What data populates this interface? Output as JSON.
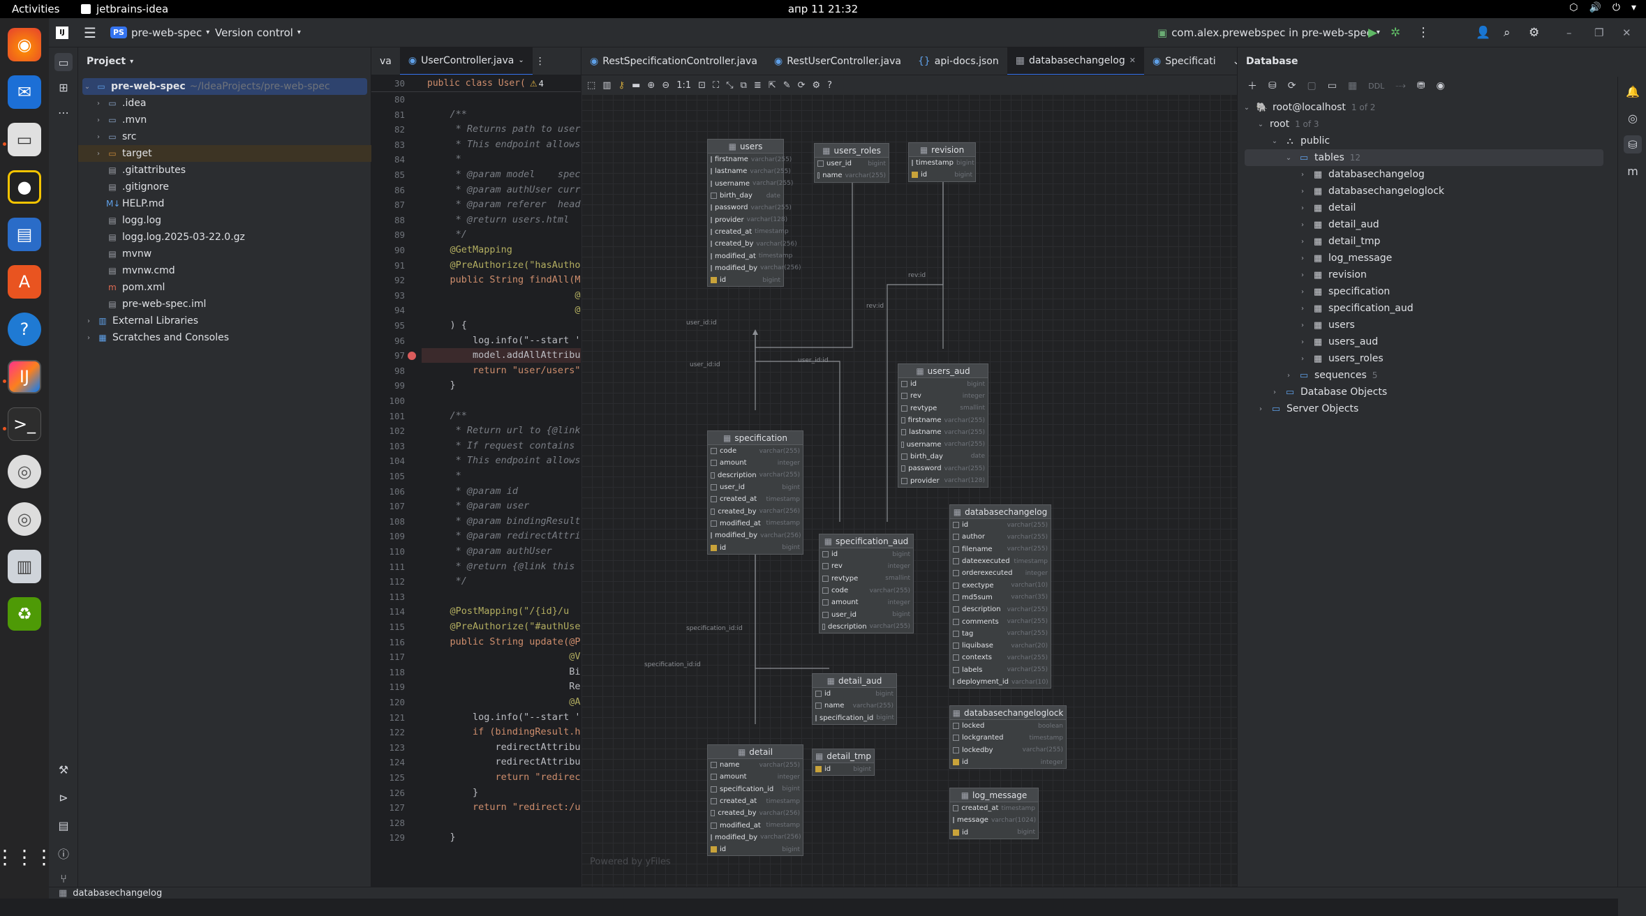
{
  "os": {
    "activities": "Activities",
    "app_name": "jetbrains-idea",
    "clock": "апр 11  21:32"
  },
  "ide": {
    "project_badge": "PS",
    "project_name": "pre-web-spec",
    "vcs_label": "Version control",
    "run_config": "com.alex.prewebspec in pre-web-spec"
  },
  "project_panel": {
    "title": "Project",
    "root": {
      "name": "pre-web-spec",
      "path": "~/IdeaProjects/pre-web-spec"
    },
    "items": [
      {
        "name": ".idea",
        "type": "folder"
      },
      {
        "name": ".mvn",
        "type": "folder"
      },
      {
        "name": "src",
        "type": "folder"
      },
      {
        "name": "target",
        "type": "folder-excluded"
      },
      {
        "name": ".gitattributes",
        "type": "file"
      },
      {
        "name": ".gitignore",
        "type": "file"
      },
      {
        "name": "HELP.md",
        "type": "md"
      },
      {
        "name": "logg.log",
        "type": "file"
      },
      {
        "name": "logg.log.2025-03-22.0.gz",
        "type": "file"
      },
      {
        "name": "mvnw",
        "type": "file"
      },
      {
        "name": "mvnw.cmd",
        "type": "file"
      },
      {
        "name": "pom.xml",
        "type": "xml"
      },
      {
        "name": "pre-web-spec.iml",
        "type": "file"
      }
    ],
    "external_libraries": "External Libraries",
    "scratches": "Scratches and Consoles"
  },
  "editor_tabs": {
    "partial_left": "va",
    "active": "UserController.java"
  },
  "sticky_line": {
    "number": "30",
    "text": "public class User(",
    "warnings": "4"
  },
  "code_lines": [
    {
      "n": "80",
      "t": ""
    },
    {
      "n": "81",
      "t": "    /**"
    },
    {
      "n": "82",
      "t": "     * Returns path to users"
    },
    {
      "n": "83",
      "t": "     * This endpoint allows"
    },
    {
      "n": "84",
      "t": "     *"
    },
    {
      "n": "85",
      "t": "     * @param model    spec"
    },
    {
      "n": "86",
      "t": "     * @param authUser curr"
    },
    {
      "n": "87",
      "t": "     * @param referer  head"
    },
    {
      "n": "88",
      "t": "     * @return users.html"
    },
    {
      "n": "89",
      "t": "     */"
    },
    {
      "n": "90",
      "t": "    @GetMapping"
    },
    {
      "n": "91",
      "t": "    @PreAuthorize(\"hasAuthor"
    },
    {
      "n": "92",
      "t": "    public String findAll(Mo"
    },
    {
      "n": "93",
      "t": "                          @A"
    },
    {
      "n": "94",
      "t": "                          @("
    },
    {
      "n": "95",
      "t": "    ) {"
    },
    {
      "n": "96",
      "t": "        log.info(\"--start '"
    },
    {
      "n": "97",
      "t": "        model.addAllAttribut"
    },
    {
      "n": "98",
      "t": "        return \"user/users\""
    },
    {
      "n": "99",
      "t": "    }"
    },
    {
      "n": "100",
      "t": ""
    },
    {
      "n": "101",
      "t": "    /**"
    },
    {
      "n": "102",
      "t": "     * Return url to {@link"
    },
    {
      "n": "103",
      "t": "     * If request contains"
    },
    {
      "n": "104",
      "t": "     * This endpoint allows"
    },
    {
      "n": "105",
      "t": "     *"
    },
    {
      "n": "106",
      "t": "     * @param id"
    },
    {
      "n": "107",
      "t": "     * @param user"
    },
    {
      "n": "108",
      "t": "     * @param bindingResult"
    },
    {
      "n": "109",
      "t": "     * @param redirectAttri"
    },
    {
      "n": "110",
      "t": "     * @param authUser"
    },
    {
      "n": "111",
      "t": "     * @return {@link this"
    },
    {
      "n": "112",
      "t": "     */"
    },
    {
      "n": "113",
      "t": ""
    },
    {
      "n": "114",
      "t": "    @PostMapping(\"/{id}/u"
    },
    {
      "n": "115",
      "t": "    @PreAuthorize(\"#authUse"
    },
    {
      "n": "116",
      "t": "    public String update(@P"
    },
    {
      "n": "117",
      "t": "                         @V"
    },
    {
      "n": "118",
      "t": "                         Bi"
    },
    {
      "n": "119",
      "t": "                         Re"
    },
    {
      "n": "120",
      "t": "                         @A"
    },
    {
      "n": "121",
      "t": "        log.info(\"--start '"
    },
    {
      "n": "122",
      "t": "        if (bindingResult.ha"
    },
    {
      "n": "123",
      "t": "            redirectAttribut"
    },
    {
      "n": "124",
      "t": "            redirectAttribut"
    },
    {
      "n": "125",
      "t": "            return \"redirect:"
    },
    {
      "n": "126",
      "t": "        }"
    },
    {
      "n": "127",
      "t": "        return \"redirect:/u"
    },
    {
      "n": "128",
      "t": ""
    },
    {
      "n": "129",
      "t": "    }"
    }
  ],
  "diagram_tabs": [
    "RestSpecificationController.java",
    "RestUserController.java",
    "api-docs.json",
    "databasechangelog",
    "Specificati"
  ],
  "diagram_zoom": "1:1",
  "diagram_watermark": "Powered by yFiles",
  "edge_labels": [
    "user_id:id",
    "user_id:id",
    "user_id:id",
    "rev:id",
    "rev:id",
    "specification_id:id",
    "specification_id:id"
  ],
  "tables": [
    {
      "id": "users",
      "name": "users",
      "cols": [
        [
          "firstname",
          "varchar(255)"
        ],
        [
          "lastname",
          "varchar(255)"
        ],
        [
          "username",
          "varchar(255)"
        ],
        [
          "birth_day",
          "date"
        ],
        [
          "password",
          "varchar(255)"
        ],
        [
          "provider",
          "varchar(128)"
        ],
        [
          "created_at",
          "timestamp"
        ],
        [
          "created_by",
          "varchar(256)"
        ],
        [
          "modified_at",
          "timestamp"
        ],
        [
          "modified_by",
          "varchar(256)"
        ],
        [
          "id",
          "bigint"
        ]
      ]
    },
    {
      "id": "users_roles",
      "name": "users_roles",
      "cols": [
        [
          "user_id",
          "bigint"
        ],
        [
          "name",
          "varchar(255)"
        ]
      ]
    },
    {
      "id": "revision",
      "name": "revision",
      "cols": [
        [
          "timestamp",
          "bigint"
        ],
        [
          "id",
          "bigint"
        ]
      ]
    },
    {
      "id": "users_aud",
      "name": "users_aud",
      "cols": [
        [
          "id",
          "bigint"
        ],
        [
          "rev",
          "integer"
        ],
        [
          "revtype",
          "smallint"
        ],
        [
          "firstname",
          "varchar(255)"
        ],
        [
          "lastname",
          "varchar(255)"
        ],
        [
          "username",
          "varchar(255)"
        ],
        [
          "birth_day",
          "date"
        ],
        [
          "password",
          "varchar(255)"
        ],
        [
          "provider",
          "varchar(128)"
        ]
      ]
    },
    {
      "id": "specification",
      "name": "specification",
      "cols": [
        [
          "code",
          "varchar(255)"
        ],
        [
          "amount",
          "integer"
        ],
        [
          "description",
          "varchar(255)"
        ],
        [
          "user_id",
          "bigint"
        ],
        [
          "created_at",
          "timestamp"
        ],
        [
          "created_by",
          "varchar(256)"
        ],
        [
          "modified_at",
          "timestamp"
        ],
        [
          "modified_by",
          "varchar(256)"
        ],
        [
          "id",
          "bigint"
        ]
      ]
    },
    {
      "id": "specification_aud",
      "name": "specification_aud",
      "cols": [
        [
          "id",
          "bigint"
        ],
        [
          "rev",
          "integer"
        ],
        [
          "revtype",
          "smallint"
        ],
        [
          "code",
          "varchar(255)"
        ],
        [
          "amount",
          "integer"
        ],
        [
          "user_id",
          "bigint"
        ],
        [
          "description",
          "varchar(255)"
        ]
      ]
    },
    {
      "id": "databasechangelog",
      "name": "databasechangelog",
      "cols": [
        [
          "id",
          "varchar(255)"
        ],
        [
          "author",
          "varchar(255)"
        ],
        [
          "filename",
          "varchar(255)"
        ],
        [
          "dateexecuted",
          "timestamp"
        ],
        [
          "orderexecuted",
          "integer"
        ],
        [
          "exectype",
          "varchar(10)"
        ],
        [
          "md5sum",
          "varchar(35)"
        ],
        [
          "description",
          "varchar(255)"
        ],
        [
          "comments",
          "varchar(255)"
        ],
        [
          "tag",
          "varchar(255)"
        ],
        [
          "liquibase",
          "varchar(20)"
        ],
        [
          "contexts",
          "varchar(255)"
        ],
        [
          "labels",
          "varchar(255)"
        ],
        [
          "deployment_id",
          "varchar(10)"
        ]
      ]
    },
    {
      "id": "detail_aud",
      "name": "detail_aud",
      "cols": [
        [
          "id",
          "bigint"
        ],
        [
          "name",
          "varchar(255)"
        ],
        [
          "specification_id",
          "bigint"
        ]
      ]
    },
    {
      "id": "databasechangeloglock",
      "name": "databasechangeloglock",
      "cols": [
        [
          "locked",
          "boolean"
        ],
        [
          "lockgranted",
          "timestamp"
        ],
        [
          "lockedby",
          "varchar(255)"
        ],
        [
          "id",
          "integer"
        ]
      ]
    },
    {
      "id": "detail",
      "name": "detail",
      "cols": [
        [
          "name",
          "varchar(255)"
        ],
        [
          "amount",
          "integer"
        ],
        [
          "specification_id",
          "bigint"
        ],
        [
          "created_at",
          "timestamp"
        ],
        [
          "created_by",
          "varchar(256)"
        ],
        [
          "modified_at",
          "timestamp"
        ],
        [
          "modified_by",
          "varchar(256)"
        ],
        [
          "id",
          "bigint"
        ]
      ]
    },
    {
      "id": "detail_tmp",
      "name": "detail_tmp",
      "cols": [
        [
          "id",
          "bigint"
        ]
      ]
    },
    {
      "id": "log_message",
      "name": "log_message",
      "cols": [
        [
          "created_at",
          "timestamp"
        ],
        [
          "message",
          "varchar(1024)"
        ],
        [
          "id",
          "bigint"
        ]
      ]
    }
  ],
  "db_panel": {
    "title": "Database",
    "ddl_label": "DDL",
    "connection": {
      "name": "root@localhost",
      "count": "1 of 2"
    },
    "database": {
      "name": "root",
      "count": "1 of 3"
    },
    "schema": "public",
    "tables_folder": {
      "name": "tables",
      "count": "12"
    },
    "tables": [
      "databasechangelog",
      "databasechangeloglock",
      "detail",
      "detail_aud",
      "detail_tmp",
      "log_message",
      "revision",
      "specification",
      "specification_aud",
      "users",
      "users_aud",
      "users_roles"
    ],
    "sequences": {
      "name": "sequences",
      "count": "5"
    },
    "database_objects": "Database Objects",
    "server_objects": "Server Objects"
  },
  "status": {
    "breadcrumb": "databasechangelog"
  }
}
